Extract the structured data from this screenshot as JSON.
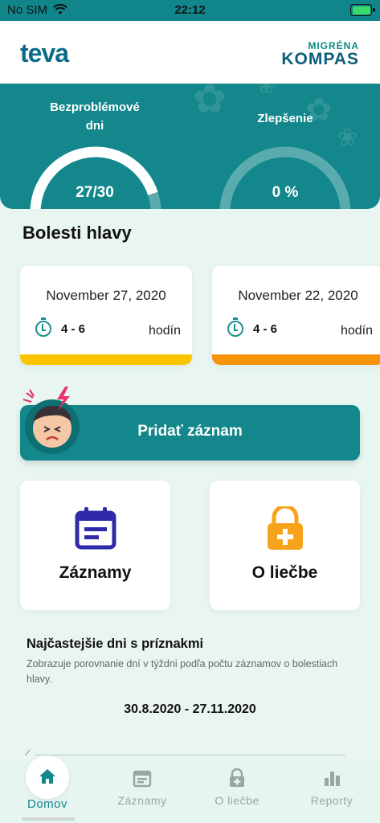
{
  "status_bar": {
    "carrier": "No SIM",
    "time": "22:12"
  },
  "header": {
    "brand_logo": "teva",
    "app_logo_top": "MIGRÉNA",
    "app_logo_bottom": "KOMPAS"
  },
  "summary": {
    "trouble_free_label": "Bezproblémové dni",
    "trouble_free_value": "27/30",
    "trouble_free_fraction": 0.9,
    "improvement_label": "Zlepšenie",
    "improvement_value": "0 %",
    "improvement_fraction": 0.0
  },
  "headaches": {
    "title": "Bolesti hlavy",
    "entries": [
      {
        "date": "November 27, 2020",
        "duration": "4 - 6",
        "unit": "hodín",
        "severity_color": "#f9c400"
      },
      {
        "date": "November 22, 2020",
        "duration": "4 - 6",
        "unit": "hodín",
        "severity_color": "#f7930a"
      }
    ]
  },
  "add_record": {
    "label": "Pridať záznam"
  },
  "tiles": {
    "records": {
      "label": "Záznamy",
      "icon": "calendar-icon",
      "color": "#2f2aa8"
    },
    "treatment": {
      "label": "O liečbe",
      "icon": "lock-plus-icon",
      "color": "#f7a21b"
    }
  },
  "stats": {
    "title": "Najčastejšie dni s príznakmi",
    "description": "Zobrazuje porovnanie dní v týždni podľa počtu záznamov o bolestiach hlavy.",
    "range": "30.8.2020 - 27.11.2020"
  },
  "tab_bar": {
    "home": "Domov",
    "records": "Záznamy",
    "treatment": "O liečbe",
    "reports": "Reporty"
  },
  "colors": {
    "primary": "#13878b",
    "active_tab": "#13878b",
    "inactive_tab": "#9aa6a4"
  }
}
